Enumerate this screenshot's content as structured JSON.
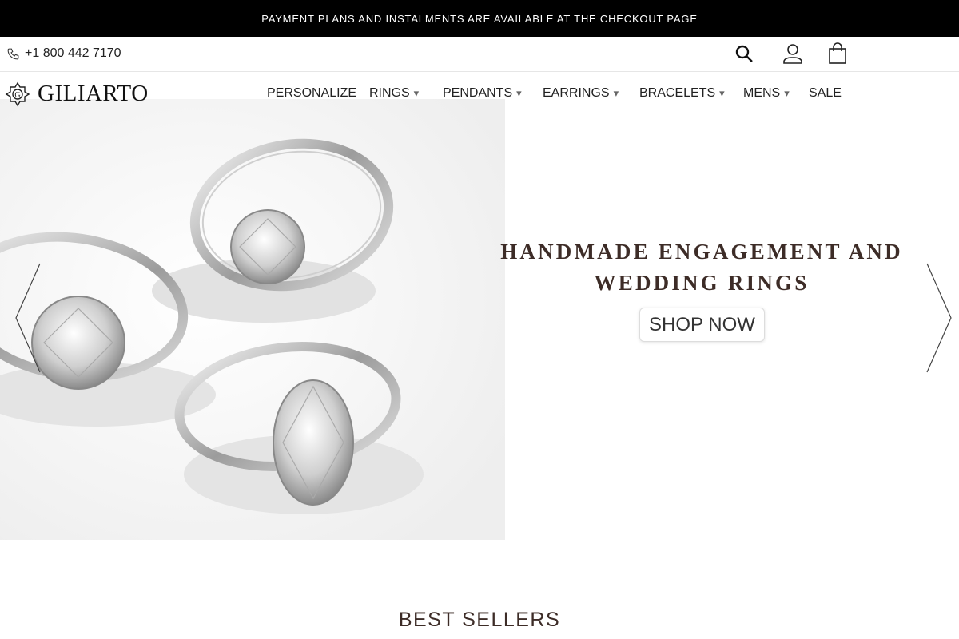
{
  "announcement": "PAYMENT PLANS AND INSTALMENTS ARE AVAILABLE AT THE CHECKOUT PAGE",
  "utility": {
    "phone": "+1 800 442 7170",
    "icons": [
      "search-icon",
      "account-icon",
      "cart-bag-icon"
    ]
  },
  "brand": {
    "name": "GILIARTO",
    "logo_letter": "G"
  },
  "nav": {
    "personalize": "PERSONALIZE",
    "rings": "RINGS",
    "pendants": "PENDANTS",
    "earrings": "EARRINGS",
    "bracelets": "BRACELETS",
    "mens": "MENS",
    "sale": "SALE",
    "caret": "▾"
  },
  "hero": {
    "heading_line1": "HANDMADE ENGAGEMENT AND",
    "heading_line2": "WEDDING RINGS",
    "cta": "SHOP NOW"
  },
  "sections": {
    "best_sellers": "BEST SELLERS"
  },
  "colors": {
    "announcement_bg": "#000000",
    "heading": "#3d2c27",
    "text": "#222222"
  }
}
